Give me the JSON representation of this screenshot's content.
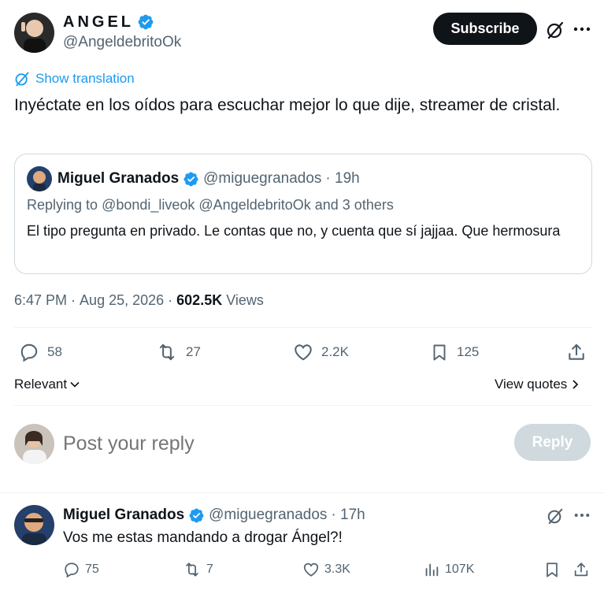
{
  "author": {
    "display_name": "ANGEL",
    "handle": "@AngeldebritoOk"
  },
  "header": {
    "subscribe_label": "Subscribe",
    "grok_icon": "grok-icon",
    "more_icon": "more-icon"
  },
  "translation": {
    "label": "Show translation"
  },
  "tweet": {
    "text": "Inyéctate en los oídos para escuchar mejor lo que dije, streamer de cristal."
  },
  "quote": {
    "display_name": "Miguel Granados",
    "handle": "@miguegranados",
    "time": "· 19h",
    "replying_prefix": "Replying to",
    "replying_users": "@bondi_liveok @AngeldebritoOk",
    "replying_suffix": "and 3 others",
    "text": "El tipo pregunta en privado. Le contas que no, y cuenta que sí jajjaa. Que hermosura"
  },
  "meta": {
    "time": "6:47 PM",
    "date": "Aug 25, 2026",
    "views_count": "602.5K",
    "views_label": "Views"
  },
  "actions": {
    "replies": "58",
    "reposts": "27",
    "likes": "2.2K",
    "bookmarks": "125"
  },
  "sort": {
    "relevant_label": "Relevant",
    "view_quotes_label": "View quotes"
  },
  "composer": {
    "placeholder": "Post your reply",
    "reply_button": "Reply"
  },
  "reply": {
    "display_name": "Miguel Granados",
    "handle": "@miguegranados",
    "time": "· 17h",
    "text": "Vos me estas mandando a drogar Ángel?!",
    "replies": "75",
    "reposts": "7",
    "likes": "3.3K",
    "views": "107K"
  },
  "colors": {
    "accent": "#1d9bf0",
    "text": "#0f1419",
    "muted": "#536471",
    "border": "#cfd9de"
  }
}
